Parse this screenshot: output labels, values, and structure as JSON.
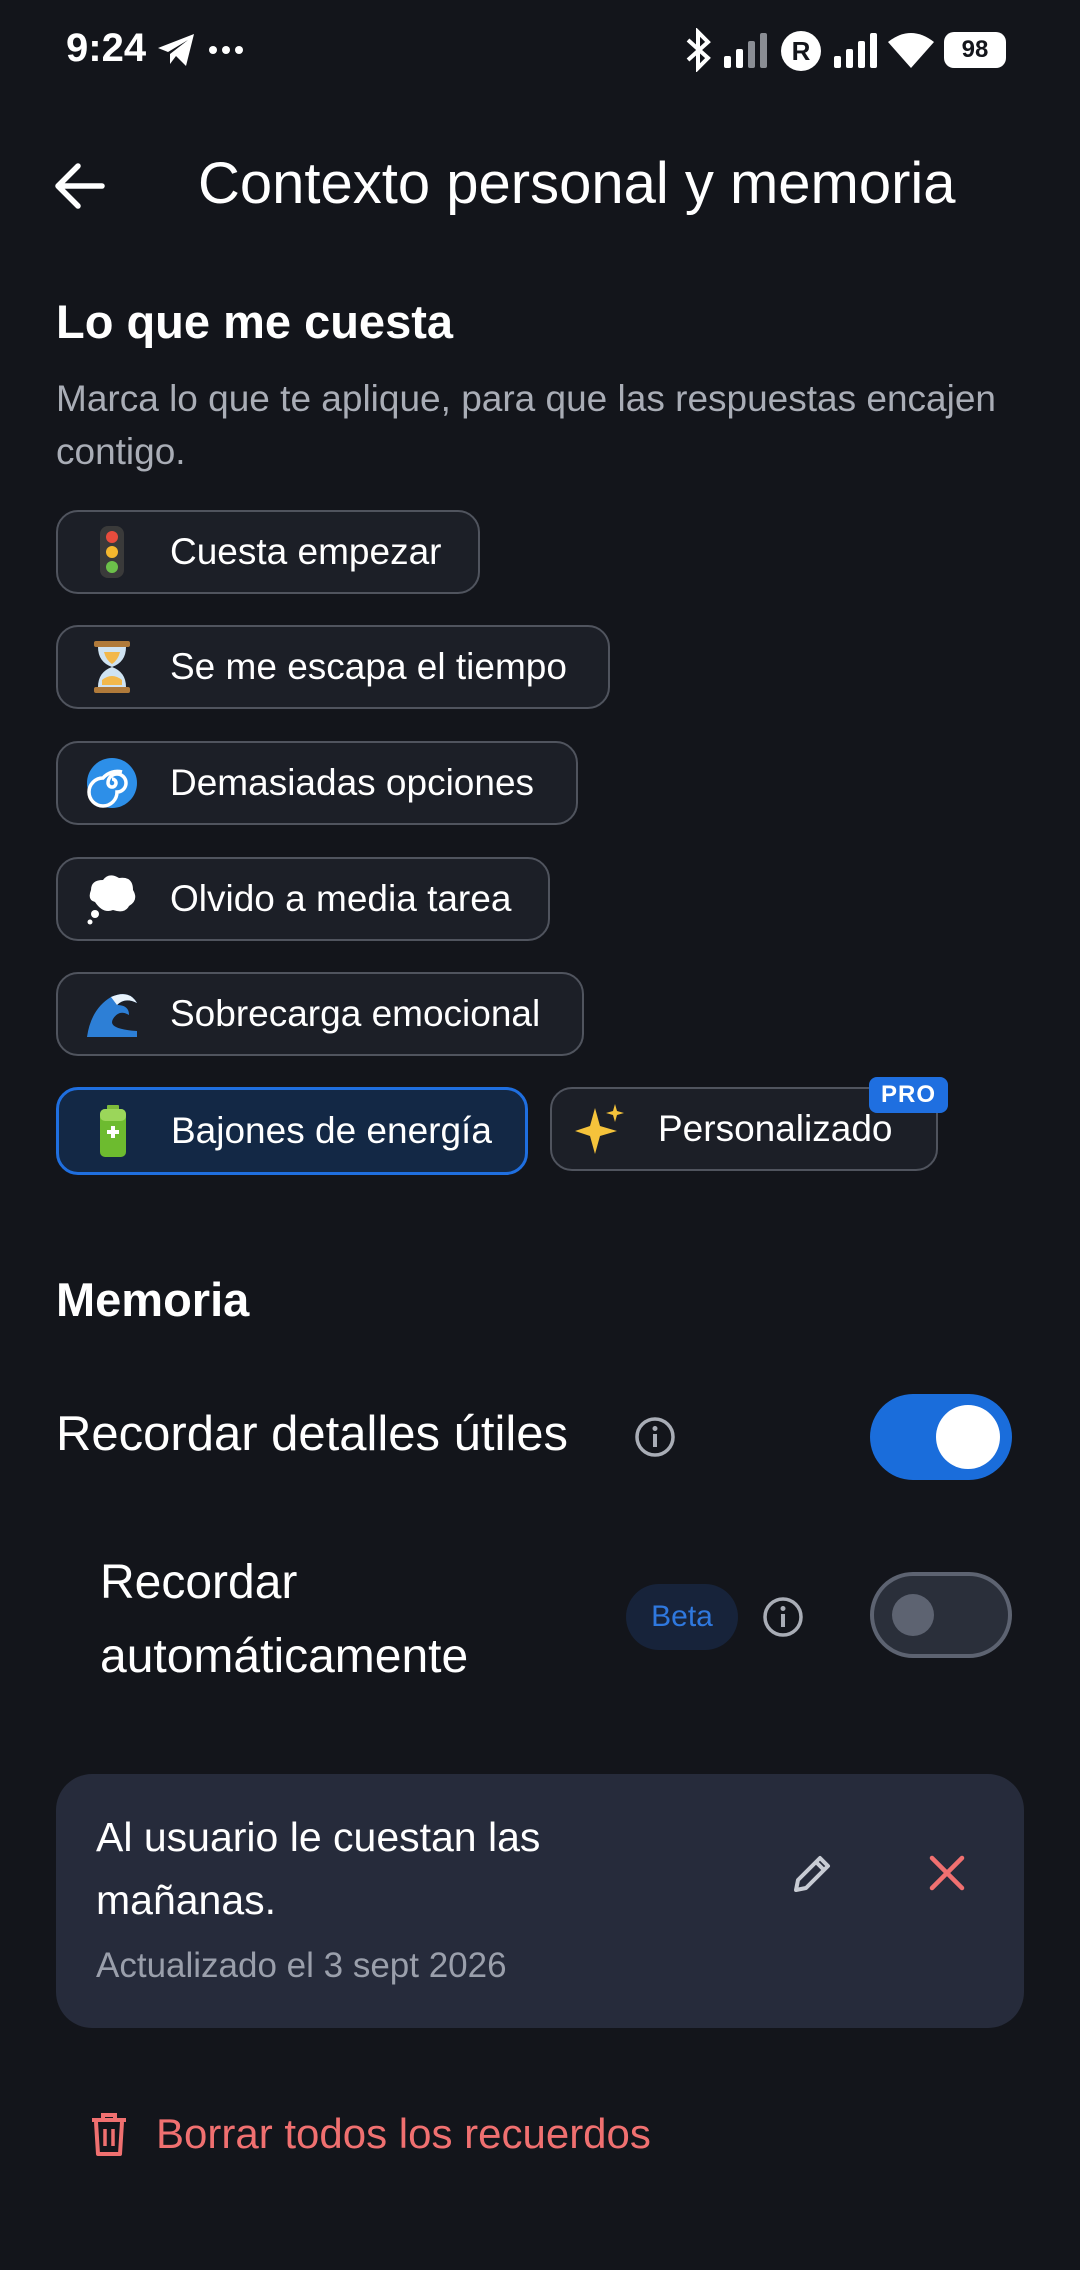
{
  "status_bar": {
    "time": "9:24",
    "battery": "98",
    "icons": [
      "telegram-icon",
      "more-dots-icon",
      "bluetooth-icon",
      "signal-icon",
      "roaming-icon",
      "signal-icon",
      "wifi-icon",
      "battery-icon"
    ]
  },
  "header": {
    "title": "Contexto personal y memoria",
    "back_icon": "arrow-left-icon"
  },
  "struggles": {
    "heading": "Lo que me cuesta",
    "description": "Marca lo que te aplique, para que las respuestas encajen contigo.",
    "chips": [
      {
        "label": "Cuesta empezar",
        "icon": "traffic-light-icon",
        "selected": false
      },
      {
        "label": "Se me escapa el tiempo",
        "icon": "hourglass-icon",
        "selected": false
      },
      {
        "label": "Demasiadas opciones",
        "icon": "cyclone-icon",
        "selected": false
      },
      {
        "label": "Olvido a media tarea",
        "icon": "thought-bubble-icon",
        "selected": false
      },
      {
        "label": "Sobrecarga emocional",
        "icon": "wave-icon",
        "selected": false
      },
      {
        "label": "Bajones de energía",
        "icon": "battery-icon",
        "selected": true
      },
      {
        "label": "Personalizado",
        "icon": "sparkles-icon",
        "selected": false,
        "badge": "PRO"
      }
    ]
  },
  "memory": {
    "heading": "Memoria",
    "remember_details": {
      "label": "Recordar detalles útiles",
      "enabled": true
    },
    "auto_remember": {
      "label_line1": "Recordar",
      "label_line2": "automáticamente",
      "badge": "Beta",
      "enabled": false
    },
    "entry": {
      "text": "Al usuario le cuestan las mañanas.",
      "updated": "Actualizado el 3 sept 2026"
    },
    "delete_all_label": "Borrar todos los recuerdos"
  },
  "colors": {
    "background": "#13151b",
    "accent": "#1f6fe0",
    "danger": "#f07070",
    "card": "#262b3b"
  }
}
